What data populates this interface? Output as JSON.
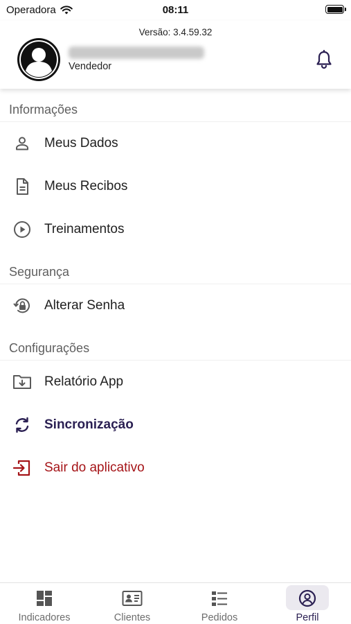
{
  "status_bar": {
    "carrier": "Operadora",
    "time": "08:11",
    "wifi_icon": "wifi-icon",
    "battery_icon": "battery-icon"
  },
  "header": {
    "version": "Versão: 3.4.59.32",
    "user_role": "Vendedor",
    "avatar_icon": "person-avatar-icon",
    "notification_icon": "bell-icon"
  },
  "sections": [
    {
      "title": "Informações",
      "items": [
        {
          "label": "Meus Dados",
          "icon": "person-icon"
        },
        {
          "label": "Meus Recibos",
          "icon": "document-icon"
        },
        {
          "label": "Treinamentos",
          "icon": "play-circle-icon"
        }
      ]
    },
    {
      "title": "Segurança",
      "items": [
        {
          "label": "Alterar Senha",
          "icon": "lock-reset-icon"
        }
      ]
    },
    {
      "title": "Configurações",
      "items": [
        {
          "label": "Relatório App",
          "icon": "folder-download-icon"
        },
        {
          "label": "Sincronização",
          "icon": "sync-icon"
        },
        {
          "label": "Sair do aplicativo",
          "icon": "logout-icon"
        }
      ]
    }
  ],
  "tab_bar": {
    "tabs": [
      {
        "label": "Indicadores",
        "icon": "dashboard-icon"
      },
      {
        "label": "Clientes",
        "icon": "contact-card-icon"
      },
      {
        "label": "Pedidos",
        "icon": "list-icon"
      },
      {
        "label": "Perfil",
        "icon": "profile-circle-icon"
      }
    ],
    "active": "Perfil"
  },
  "colors": {
    "primary": "#2a1f52",
    "danger": "#a51418",
    "section_title": "#5f5f5f",
    "icon_gray": "#5a5a5a"
  }
}
